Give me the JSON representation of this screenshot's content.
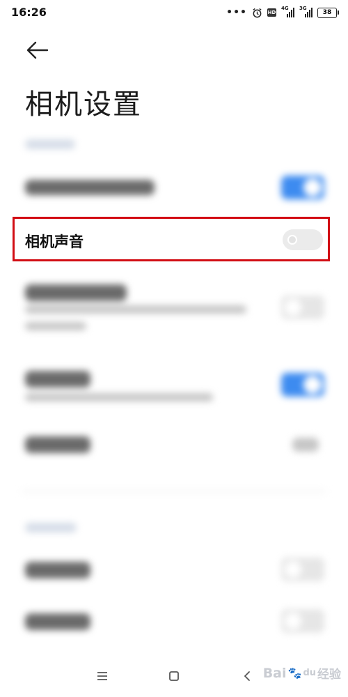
{
  "status_bar": {
    "time": "16:26",
    "dots": "•••",
    "hd": "HD",
    "network1": "4G",
    "network2": "3G",
    "battery": "38"
  },
  "header": {
    "title": "相机设置"
  },
  "camera_sound": {
    "label": "相机声音",
    "enabled": false
  },
  "colors": {
    "highlight": "#d20d14",
    "toggle_on": "#3d8bf0",
    "toggle_off": "#ebebeb"
  },
  "icons": {
    "back": "back-arrow-icon",
    "menu": "menu-icon",
    "home": "home-icon",
    "back_nav": "chevron-left-icon"
  },
  "watermark": {
    "text": "Bai",
    "logo": "du",
    "suffix": "经验"
  }
}
